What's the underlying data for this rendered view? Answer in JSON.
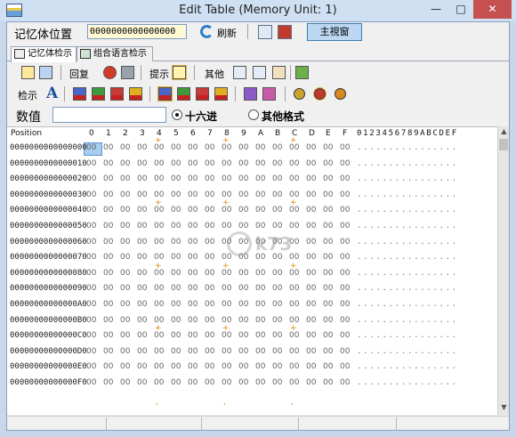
{
  "window": {
    "title": "Edit Table (Memory Unit: 1)",
    "min_label": "—",
    "max_label": "□",
    "close_label": "✕"
  },
  "row1": {
    "addr_label": "记忆体位置",
    "addr_value": "0000000000000000",
    "refresh_label": "刷新",
    "main_view_label": "主視窗"
  },
  "tabs": [
    {
      "label": "记忆体检示"
    },
    {
      "label": "组合语言检示"
    }
  ],
  "toolbar1": {
    "back_label": "回复",
    "hint_label": "提示",
    "other_label": "其他"
  },
  "toolbar2": {
    "view_label": "检示"
  },
  "value_row": {
    "label": "数值",
    "radio_hex": "十六进",
    "radio_other": "其他格式"
  },
  "grid": {
    "position_header": "Position",
    "hex_headers": [
      "0",
      "1",
      "2",
      "3",
      "4",
      "5",
      "6",
      "7",
      "8",
      "9",
      "A",
      "B",
      "C",
      "D",
      "E",
      "F"
    ],
    "ascii_header": "0123456789ABCDEF",
    "rows": [
      "0000000000000000",
      "0000000000000010",
      "0000000000000020",
      "0000000000000030",
      "0000000000000040",
      "0000000000000050",
      "0000000000000060",
      "0000000000000070",
      "0000000000000080",
      "0000000000000090",
      "00000000000000A0",
      "00000000000000B0",
      "00000000000000C0",
      "00000000000000D0",
      "00000000000000E0",
      "00000000000000F0"
    ],
    "cell_value": "00",
    "ascii_row": "................",
    "marker": "+",
    "tick_marker": "'"
  },
  "watermark": {
    "text": "k73"
  },
  "colors": {
    "selected_cell": "#a9cdf0",
    "window_frame": "#c8d8ea",
    "close_button": "#c75050",
    "marker": "#e08a00"
  }
}
